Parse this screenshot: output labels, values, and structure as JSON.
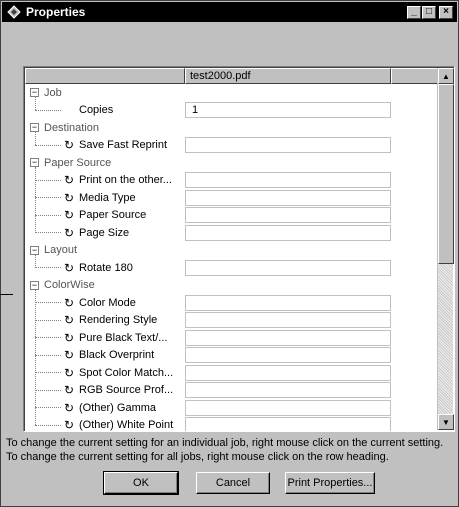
{
  "window": {
    "title": "Properties"
  },
  "title_buttons": {
    "minimize": "_",
    "maximize": "□",
    "close": "×"
  },
  "grid": {
    "headers": [
      "",
      "test2000.pdf",
      ""
    ],
    "rows": [
      {
        "kind": "group",
        "label": "Job",
        "value": null
      },
      {
        "kind": "item",
        "label": "Copies",
        "value": "1",
        "icon": "none"
      },
      {
        "kind": "group",
        "label": "Destination",
        "value": null
      },
      {
        "kind": "item",
        "label": "Save Fast Reprint",
        "value": "",
        "icon": "cycle"
      },
      {
        "kind": "group",
        "label": "Paper Source",
        "value": null
      },
      {
        "kind": "item",
        "label": "Print on the other...",
        "value": "",
        "icon": "cycle"
      },
      {
        "kind": "item",
        "label": "Media Type",
        "value": "",
        "icon": "cycle"
      },
      {
        "kind": "item",
        "label": "Paper Source",
        "value": "",
        "icon": "cycle"
      },
      {
        "kind": "item",
        "label": "Page Size",
        "value": "",
        "icon": "cycle"
      },
      {
        "kind": "group",
        "label": "Layout",
        "value": null
      },
      {
        "kind": "item",
        "label": "Rotate 180",
        "value": "",
        "icon": "cycle"
      },
      {
        "kind": "group",
        "label": "ColorWise",
        "value": null
      },
      {
        "kind": "item",
        "label": "Color Mode",
        "value": "",
        "icon": "cycle"
      },
      {
        "kind": "item",
        "label": "Rendering Style",
        "value": "",
        "icon": "cycle"
      },
      {
        "kind": "item",
        "label": "Pure Black Text/...",
        "value": "",
        "icon": "cycle"
      },
      {
        "kind": "item",
        "label": "Black Overprint",
        "value": "",
        "icon": "cycle"
      },
      {
        "kind": "item",
        "label": "Spot Color Match...",
        "value": "",
        "icon": "cycle"
      },
      {
        "kind": "item",
        "label": "RGB Source Prof...",
        "value": "",
        "icon": "cycle"
      },
      {
        "kind": "item",
        "label": "(Other) Gamma",
        "value": "",
        "icon": "cycle"
      },
      {
        "kind": "item",
        "label": "(Other) White Point",
        "value": "",
        "icon": "cycle"
      }
    ]
  },
  "help": {
    "line1": "To change the current setting for an individual job, right mouse click on the current setting.",
    "line2": "To change the current setting for all jobs, right mouse click on the row heading."
  },
  "buttons": {
    "ok": "OK",
    "cancel": "Cancel",
    "print_properties": "Print Properties..."
  },
  "icons": {
    "expander": "⊟",
    "cycle": "↻",
    "up": "▲",
    "down": "▼"
  }
}
